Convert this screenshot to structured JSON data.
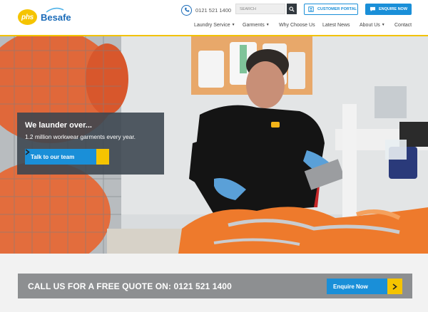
{
  "header": {
    "logo_badge": "phs",
    "logo_word": "Besafe",
    "phone": "0121 521 1400",
    "search_placeholder": "SEARCH",
    "portal_label": "CUSTOMER PORTAL",
    "enquire_label": "ENQUIRE NOW"
  },
  "nav": {
    "items": [
      {
        "label": "Laundry Service",
        "dropdown": true
      },
      {
        "label": "Garments",
        "dropdown": true
      },
      {
        "label": "Why Choose Us",
        "dropdown": false
      },
      {
        "label": "Latest News",
        "dropdown": false
      },
      {
        "label": "About Us",
        "dropdown": true
      },
      {
        "label": "Contact",
        "dropdown": false
      }
    ]
  },
  "hero": {
    "title": "We launder over...",
    "subtitle": "1.2 million workwear garments every year.",
    "button_label": "Talk to our team"
  },
  "quote": {
    "text": "CALL US FOR A FREE QUOTE ON: 0121 521 1400",
    "button_label": "Enquire Now"
  },
  "colors": {
    "brand_blue": "#1a8fd8",
    "brand_yellow": "#f5c400",
    "callout_bg": "#3a444e",
    "quote_bar": "#8d8f91"
  },
  "icons": [
    "phone-icon",
    "search-icon",
    "portal-icon",
    "chat-icon",
    "chevron-right-icon"
  ]
}
